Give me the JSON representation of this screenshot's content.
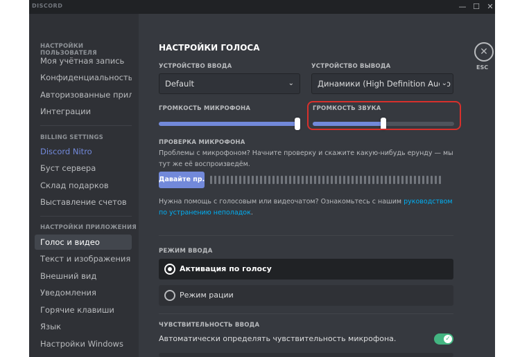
{
  "app": {
    "logo_text": "DISCORD",
    "controls": {
      "minimize": "—",
      "maximize": "☐",
      "close": "✕"
    }
  },
  "sidebar": {
    "user_settings_header": "НАСТРОЙКИ ПОЛЬЗОВАТЕЛЯ",
    "user_items": [
      "Моя учётная запись",
      "Конфиденциальность",
      "Авторизованные прил...",
      "Интеграции"
    ],
    "billing_header": "BILLING SETTINGS",
    "billing_items": [
      "Discord Nitro",
      "Буст сервера",
      "Склад подарков",
      "Выставление счетов"
    ],
    "app_settings_header": "НАСТРОЙКИ ПРИЛОЖЕНИЯ",
    "app_items": [
      "Голос и видео",
      "Текст и изображения",
      "Внешний вид",
      "Уведомления",
      "Горячие клавиши",
      "Язык",
      "Настройки Windows"
    ],
    "active_item": "Голос и видео"
  },
  "voice": {
    "title": "НАСТРОЙКИ ГОЛОСА",
    "input_device_label": "УСТРОЙСТВО ВВОДА",
    "input_device_value": "Default",
    "output_device_label": "УСТРОЙСТВО ВЫВОДА",
    "output_device_value": "Динамики (High Definition Audio De",
    "mic_volume_label": "ГРОМКОСТЬ МИКРОФОНА",
    "mic_volume_fraction": 1.0,
    "output_volume_label": "ГРОМКОСТЬ ЗВУКА",
    "output_volume_fraction": 0.5,
    "mic_test_label": "ПРОВЕРКА МИКРОФОНА",
    "mic_test_desc": "Проблемы с микрофоном? Начните проверку и скажите какую-нибудь ерунду — мы тут же её воспроизведём.",
    "mic_test_button": "Давайте пр...",
    "help_text": "Нужна помощь с голосовым или видеочатом? Ознакомьтесь с нашим ",
    "help_link": "руководством по устранению неполадок",
    "help_end": ".",
    "input_mode_label": "РЕЖИМ ВВОДА",
    "mode_voice": "Активация по голосу",
    "mode_ptt": "Режим рации",
    "sensitivity_label": "ЧУВСТВИТЕЛЬНОСТЬ ВВОДА",
    "auto_sensitivity_text": "Автоматически определять чувствительность микрофона.",
    "auto_sensitivity_on": true
  },
  "close": {
    "icon": "close-icon",
    "label": "ESC"
  },
  "colors": {
    "accent": "#7289da",
    "highlight": "#d8302c",
    "toggle_on": "#43b581",
    "link": "#00b0f4"
  }
}
